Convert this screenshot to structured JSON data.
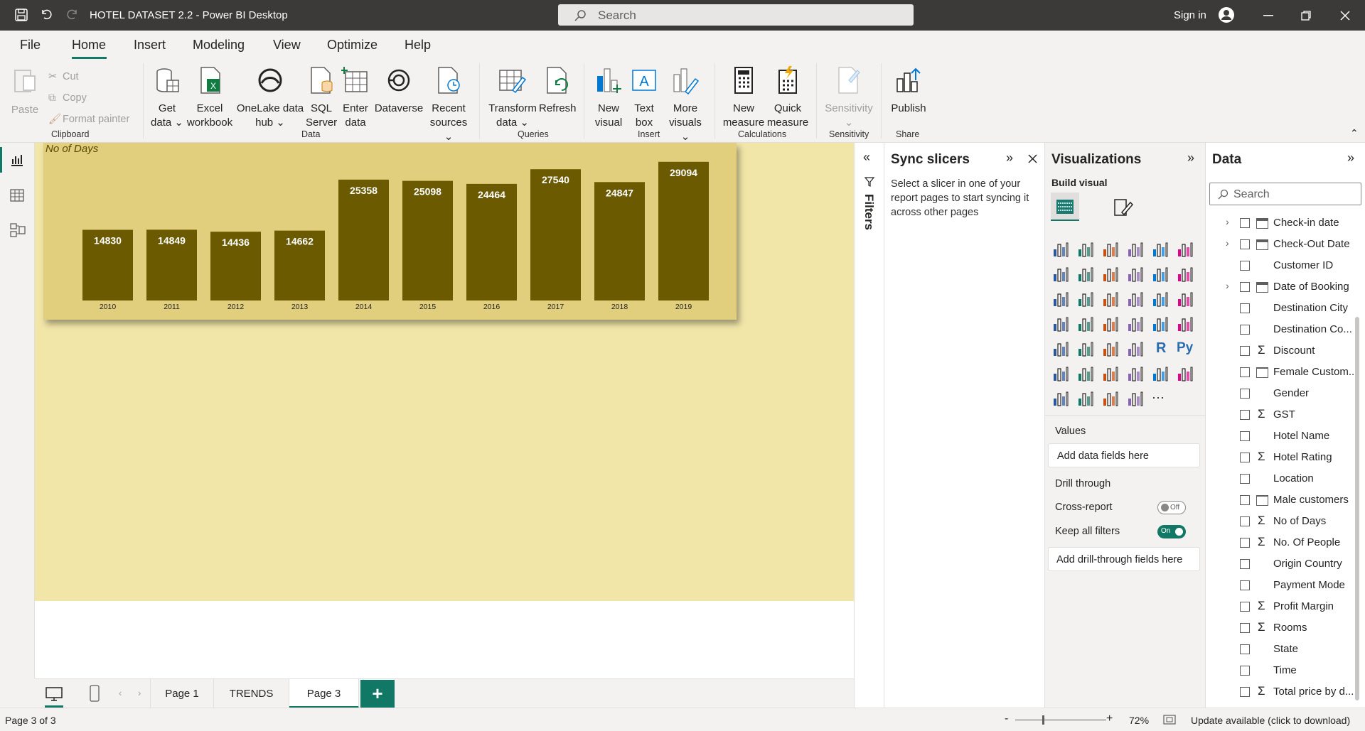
{
  "window": {
    "title": "HOTEL DATASET 2.2 - Power BI Desktop",
    "search_placeholder": "Search",
    "sign_in": "Sign in"
  },
  "menu": [
    "File",
    "Home",
    "Insert",
    "Modeling",
    "View",
    "Optimize",
    "Help"
  ],
  "ribbon": {
    "clipboard": {
      "paste": "Paste",
      "cut": "Cut",
      "copy": "Copy",
      "format_painter": "Format painter",
      "group": "Clipboard"
    },
    "data": {
      "get_data": [
        "Get",
        "data"
      ],
      "excel": [
        "Excel",
        "workbook"
      ],
      "onelake": [
        "OneLake data",
        "hub"
      ],
      "sql": [
        "SQL",
        "Server"
      ],
      "enter": [
        "Enter",
        "data"
      ],
      "dataverse": "Dataverse",
      "recent": [
        "Recent",
        "sources"
      ],
      "group": "Data"
    },
    "queries": {
      "transform": [
        "Transform",
        "data"
      ],
      "refresh": "Refresh",
      "group": "Queries"
    },
    "insert": {
      "new_visual": [
        "New",
        "visual"
      ],
      "text_box": [
        "Text",
        "box"
      ],
      "more_visuals": [
        "More",
        "visuals"
      ],
      "group": "Insert"
    },
    "calculations": {
      "new_measure": [
        "New",
        "measure"
      ],
      "quick_measure": [
        "Quick",
        "measure"
      ],
      "group": "Calculations"
    },
    "sensitivity": {
      "label": "Sensitivity",
      "group": "Sensitivity"
    },
    "share": {
      "publish": "Publish",
      "group": "Share"
    }
  },
  "chart_data": {
    "type": "bar",
    "title": "No of Days",
    "categories": [
      "2010",
      "2011",
      "2012",
      "2013",
      "2014",
      "2015",
      "2016",
      "2017",
      "2018",
      "2019"
    ],
    "values": [
      14830,
      14849,
      14436,
      14662,
      25358,
      25098,
      24464,
      27540,
      24847,
      29094
    ],
    "bar_color": "#6b5a00",
    "background": "#e1cf7e",
    "ylim": [
      0,
      31000
    ]
  },
  "filters": {
    "label": "Filters"
  },
  "sync": {
    "title": "Sync slicers",
    "description": "Select a slicer in one of your report pages to start syncing it across other pages"
  },
  "viz": {
    "title": "Visualizations",
    "build_visual": "Build visual",
    "values": "Values",
    "add_data": "Add data fields here",
    "drill_through": "Drill through",
    "cross_report": "Cross-report",
    "cross_report_state": "Off",
    "keep_filters": "Keep all filters",
    "keep_filters_state": "On",
    "add_drill": "Add drill-through fields here",
    "accent": "#117865"
  },
  "data_pane": {
    "title": "Data",
    "search_placeholder": "Search",
    "fields": [
      {
        "name": "Check-in date",
        "kind": "date",
        "expandable": true
      },
      {
        "name": "Check-Out Date",
        "kind": "date",
        "expandable": true
      },
      {
        "name": "Customer ID",
        "kind": "text"
      },
      {
        "name": "Date of Booking",
        "kind": "date",
        "expandable": true
      },
      {
        "name": "Destination City",
        "kind": "text"
      },
      {
        "name": "Destination Co...",
        "kind": "text"
      },
      {
        "name": "Discount",
        "kind": "sum"
      },
      {
        "name": "Female Custom...",
        "kind": "calc"
      },
      {
        "name": "Gender",
        "kind": "text"
      },
      {
        "name": "GST",
        "kind": "sum"
      },
      {
        "name": "Hotel Name",
        "kind": "text"
      },
      {
        "name": "Hotel Rating",
        "kind": "sum"
      },
      {
        "name": "Location",
        "kind": "text"
      },
      {
        "name": "Male customers",
        "kind": "calc"
      },
      {
        "name": "No of Days",
        "kind": "sum"
      },
      {
        "name": "No. Of People",
        "kind": "sum"
      },
      {
        "name": "Origin Country",
        "kind": "text"
      },
      {
        "name": "Payment Mode",
        "kind": "text"
      },
      {
        "name": "Profit Margin",
        "kind": "sum"
      },
      {
        "name": "Rooms",
        "kind": "sum"
      },
      {
        "name": "State",
        "kind": "text"
      },
      {
        "name": "Time",
        "kind": "text"
      },
      {
        "name": "Total price by d...",
        "kind": "sum"
      }
    ]
  },
  "pages": [
    "Page 1",
    "TRENDS",
    "Page 3"
  ],
  "status": {
    "page": "Page 3 of 3",
    "zoom": "72%",
    "update": "Update available (click to download)"
  }
}
